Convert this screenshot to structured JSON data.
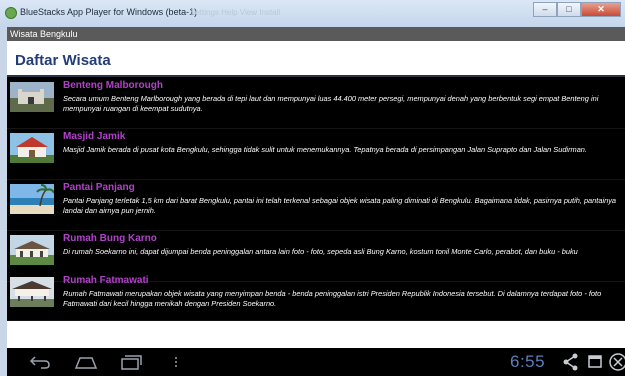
{
  "window": {
    "title": "BlueStacks App Player for Windows (beta-1)",
    "faded_menu": "Settings    Help    View    Install",
    "min_label": "–",
    "max_label": "□",
    "close_label": "✕"
  },
  "app": {
    "title": "Wisata Bengkulu",
    "heading": "Daftar Wisata"
  },
  "items": [
    {
      "title": "Benteng Malborough",
      "desc": "Secara umum Benteng Marlborough yang berada di tepi laut dan mempunyai luas 44.400 meter persegi, mempunyai denah yang berbentuk segi empat Benteng ini mempunyai ruangan di keempat sudutnya.",
      "thumb": "fort-photo"
    },
    {
      "title": "Masjid Jamik",
      "desc": "Masjid Jamik berada di pusat kota Bengkulu, sehingga tidak sulit untuk menemukannya. Tepatnya berada di persimpangan Jalan Suprapto dan Jalan Sudirman.",
      "thumb": "mosque-photo"
    },
    {
      "title": "Pantai Panjang",
      "desc": "Pantai Panjang terletak 1,5 km dari barat Bengkulu, pantai ini telah terkenal sebagai objek wisata paling diminati di Bengkulu. Bagaimana tidak, pasirnya putih, pantainya landai dan airnya pun jernih.",
      "thumb": "beach-photo"
    },
    {
      "title": "Rumah Bung Karno",
      "desc": "Di rumah Soekarno ini, dapat dijumpai benda peninggalan antara lain foto - foto, sepeda asli Bung Karno, kostum tonil Monte Carlo, perabot, dan buku - buku",
      "thumb": "house-photo"
    },
    {
      "title": "Rumah Fatmawati",
      "desc": "Rumah Fatmawati merupakan objek wisata yang menyimpan benda - benda peninggalan istri Presiden Republik Indonesia tersebut. Di dalamnya terdapat foto - foto Fatmawati dari kecil hingga menikah dengan Presiden Soekarno.",
      "thumb": "stilt-house-photo"
    }
  ],
  "navbar": {
    "clock": "6:55",
    "icons": [
      "back-icon",
      "home-icon",
      "recent-apps-icon",
      "menu-icon",
      "share-icon",
      "window-icon",
      "close-icon"
    ]
  },
  "colors": {
    "item_title": "#b141c9",
    "heading": "#243d7a",
    "clock": "#5b7fb8"
  }
}
